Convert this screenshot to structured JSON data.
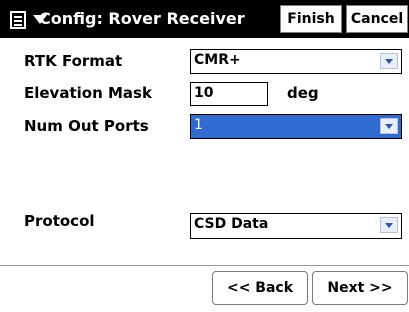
{
  "window": {
    "title": "Config: Rover Receiver",
    "menu_icon": "menu-grid-icon",
    "finish_label": "Finish",
    "cancel_label": "Cancel"
  },
  "form": {
    "rtk_format": {
      "label": "RTK Format",
      "value": "CMR+"
    },
    "elevation_mask": {
      "label": "Elevation Mask",
      "value": "10",
      "unit": "deg"
    },
    "num_out_ports": {
      "label": "Num Out Ports",
      "value": "1"
    },
    "protocol": {
      "label": "Protocol",
      "value": "CSD Data"
    }
  },
  "nav": {
    "back_label": "<< Back",
    "next_label": "Next >>"
  },
  "colors": {
    "titlebar": "#000000",
    "selection": "#2f6bd1",
    "dropdown_arrow": "#2f58b0"
  }
}
